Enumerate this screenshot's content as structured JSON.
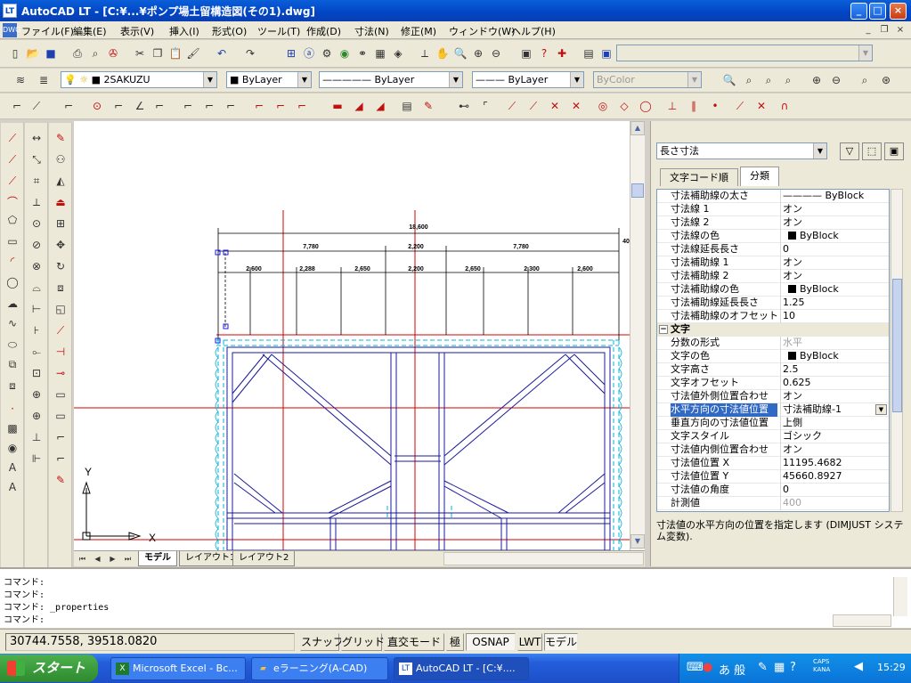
{
  "window": {
    "title": "AutoCAD LT - [C:¥...¥ポンプ場土留構造図(その1).dwg]",
    "app_icon_text": "LT",
    "minimize": "_",
    "maximize": "□",
    "close": "×"
  },
  "menu": {
    "items": [
      "ファイル(F)",
      "編集(E)",
      "表示(V)",
      "挿入(I)",
      "形式(O)",
      "ツール(T)",
      "作成(D)",
      "寸法(N)",
      "修正(M)",
      "ウィンドウ(W)",
      "ヘルプ(H)"
    ],
    "mdi_minimize": "_",
    "mdi_restore": "❐",
    "mdi_close": "×"
  },
  "layers_toolbar": {
    "layer": "2SAKUZU",
    "color": "ByLayer",
    "linetype": "ByLayer",
    "lineweight": "ByLayer",
    "plotstyle": "ByColor"
  },
  "drawing": {
    "dims": {
      "total": "18,600",
      "mid": [
        "7,780",
        "2,200",
        "7,780"
      ],
      "bottom": [
        "2,600",
        "2,288",
        "2,650",
        "2,200",
        "2,650",
        "2,300",
        "2,600"
      ],
      "side": "40"
    },
    "ucs_y": "Y",
    "ucs_x": "X"
  },
  "layout_tabs": [
    "モデル",
    "レイアウト1",
    "レイアウト2"
  ],
  "properties": {
    "selector": "長さ寸法",
    "tabs": [
      "文字コード順",
      "分類"
    ],
    "rows": [
      {
        "name": "寸法補助線の太さ",
        "value": "———— ByBlock"
      },
      {
        "name": "寸法線 1",
        "value": "オン"
      },
      {
        "name": "寸法線 2",
        "value": "オン"
      },
      {
        "name": "寸法線の色",
        "value": "ByBlock",
        "swatch": true
      },
      {
        "name": "寸法線延長長さ",
        "value": "0"
      },
      {
        "name": "寸法補助線 1",
        "value": "オン"
      },
      {
        "name": "寸法補助線 2",
        "value": "オン"
      },
      {
        "name": "寸法補助線の色",
        "value": "ByBlock",
        "swatch": true
      },
      {
        "name": "寸法補助線延長長さ",
        "value": "1.25"
      },
      {
        "name": "寸法補助線のオフセット",
        "value": "10"
      },
      {
        "name": "文字",
        "value": "",
        "category": true
      },
      {
        "name": "分数の形式",
        "value": "水平",
        "disabled": true
      },
      {
        "name": "文字の色",
        "value": "ByBlock",
        "swatch": true
      },
      {
        "name": "文字高さ",
        "value": "2.5"
      },
      {
        "name": "文字オフセット",
        "value": "0.625"
      },
      {
        "name": "寸法値外側位置合わせ",
        "value": "オン"
      },
      {
        "name": "水平方向の寸法値位置",
        "value": "寸法補助線-1",
        "highlight": true
      },
      {
        "name": "垂直方向の寸法値位置",
        "value": "上側"
      },
      {
        "name": "文字スタイル",
        "value": "ゴシック"
      },
      {
        "name": "寸法値内側位置合わせ",
        "value": "オン"
      },
      {
        "name": "寸法値位置 X",
        "value": "11195.4682"
      },
      {
        "name": "寸法値位置 Y",
        "value": "45660.8927"
      },
      {
        "name": "寸法値の角度",
        "value": "0"
      },
      {
        "name": "計測値",
        "value": "400",
        "disabled": true
      }
    ],
    "description": "寸法値の水平方向の位置を指定します (DIMJUST システム変数)."
  },
  "command": {
    "lines": [
      "コマンド:",
      "コマンド:",
      "コマンド: _properties",
      "コマンド:"
    ]
  },
  "status": {
    "coords": "30744.7558, 39518.0820",
    "buttons": [
      "スナップ",
      "グリッド",
      "直交モード",
      "極",
      "OSNAP",
      "LWT",
      "モデル"
    ]
  },
  "taskbar": {
    "start": "スタート",
    "tasks": [
      "Microsoft Excel - Bc...",
      "eラーニング(A-CAD)",
      "AutoCAD LT - [C:¥...."
    ],
    "tray_text": "あ 般",
    "caps": "CAPS",
    "kana": "KANA",
    "clock": "15:29"
  },
  "colors": {
    "title_bar": "#0245c4",
    "selection": "#316ac5",
    "drawing_red": "#d40000",
    "drawing_blue": "#1a1a9c",
    "drawing_cyan": "#00b4d8"
  }
}
